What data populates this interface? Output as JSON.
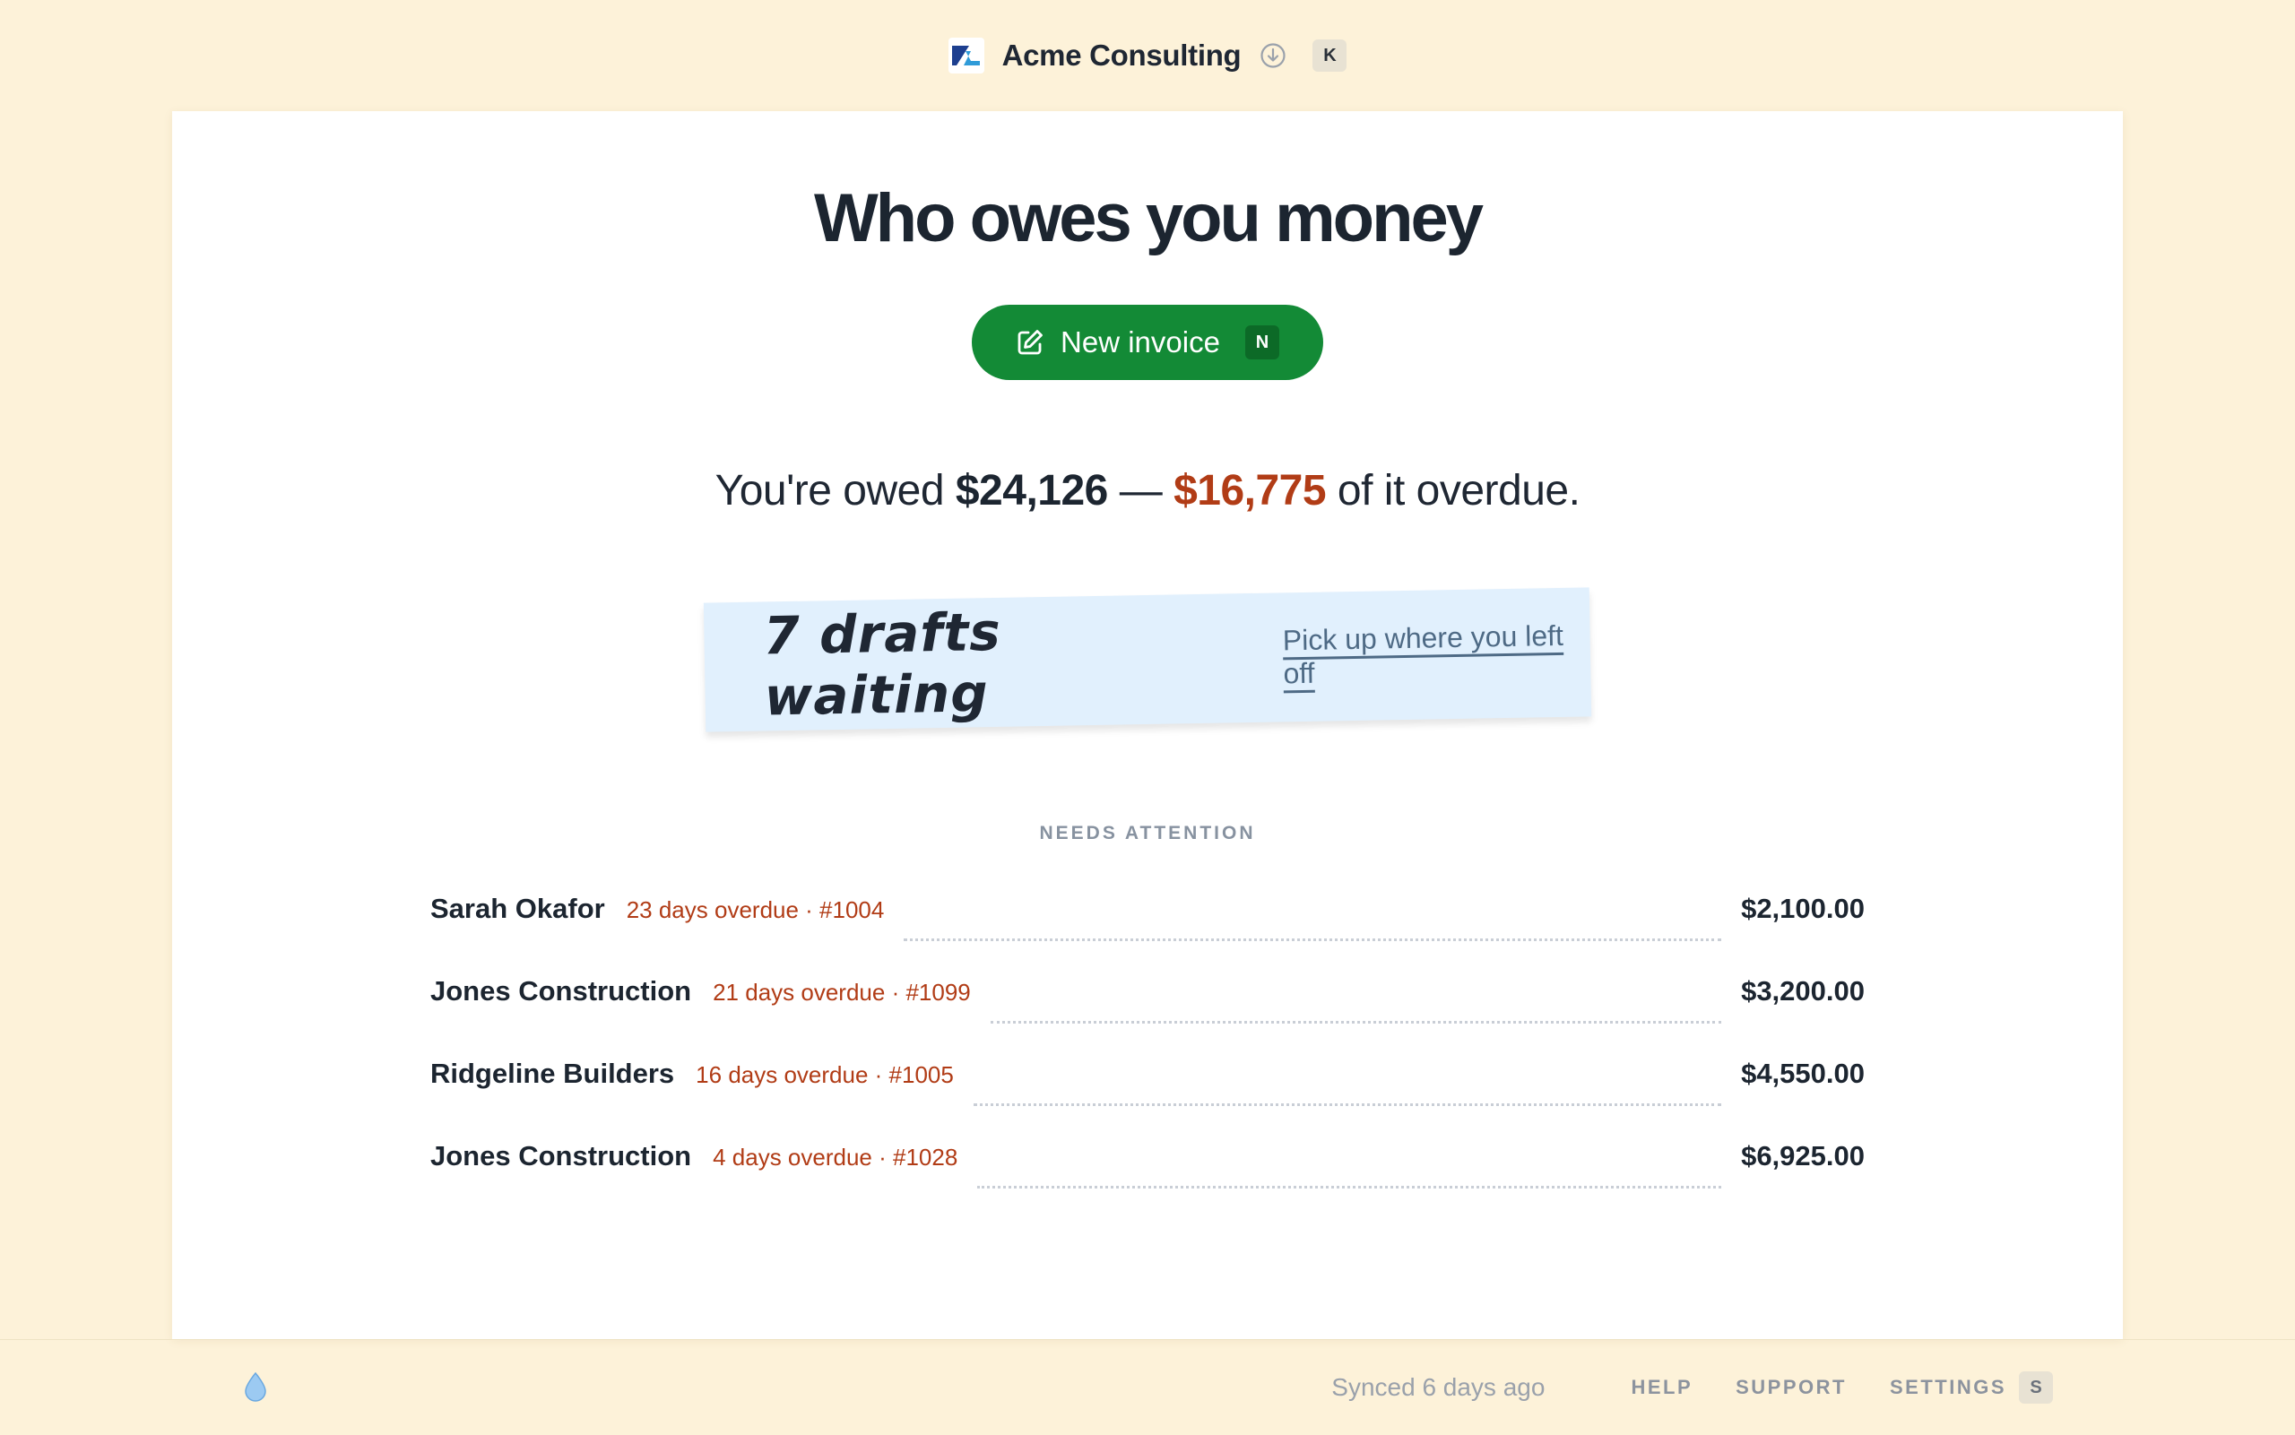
{
  "header": {
    "company_name": "Acme Consulting",
    "logo_text": "ZL",
    "shortcut_key": "K"
  },
  "main": {
    "title": "Who owes you money",
    "new_invoice": {
      "label": "New invoice",
      "shortcut": "N"
    },
    "summary": {
      "prefix": "You're owed",
      "total": "$24,126",
      "dash": "—",
      "overdue": "$16,775",
      "suffix": "of it overdue."
    },
    "drafts_note": {
      "headline": "7 drafts waiting",
      "link": "Pick up where you left off"
    },
    "section_label": "NEEDS ATTENTION",
    "rows": [
      {
        "name": "Sarah Okafor",
        "meta": "23 days overdue · #1004",
        "amount": "$2,100.00"
      },
      {
        "name": "Jones Construction",
        "meta": "21 days overdue · #1099",
        "amount": "$3,200.00"
      },
      {
        "name": "Ridgeline Builders",
        "meta": "16 days overdue · #1005",
        "amount": "$4,550.00"
      },
      {
        "name": "Jones Construction",
        "meta": "4 days overdue · #1028",
        "amount": "$6,925.00"
      }
    ]
  },
  "footer": {
    "synced": "Synced 6 days ago",
    "help": "HELP",
    "support": "SUPPORT",
    "settings": "SETTINGS",
    "settings_shortcut": "S"
  },
  "colors": {
    "background": "#fdf2d9",
    "accent_green": "#138a36",
    "overdue_red": "#b13c16",
    "note_blue": "#e1f0fd"
  }
}
